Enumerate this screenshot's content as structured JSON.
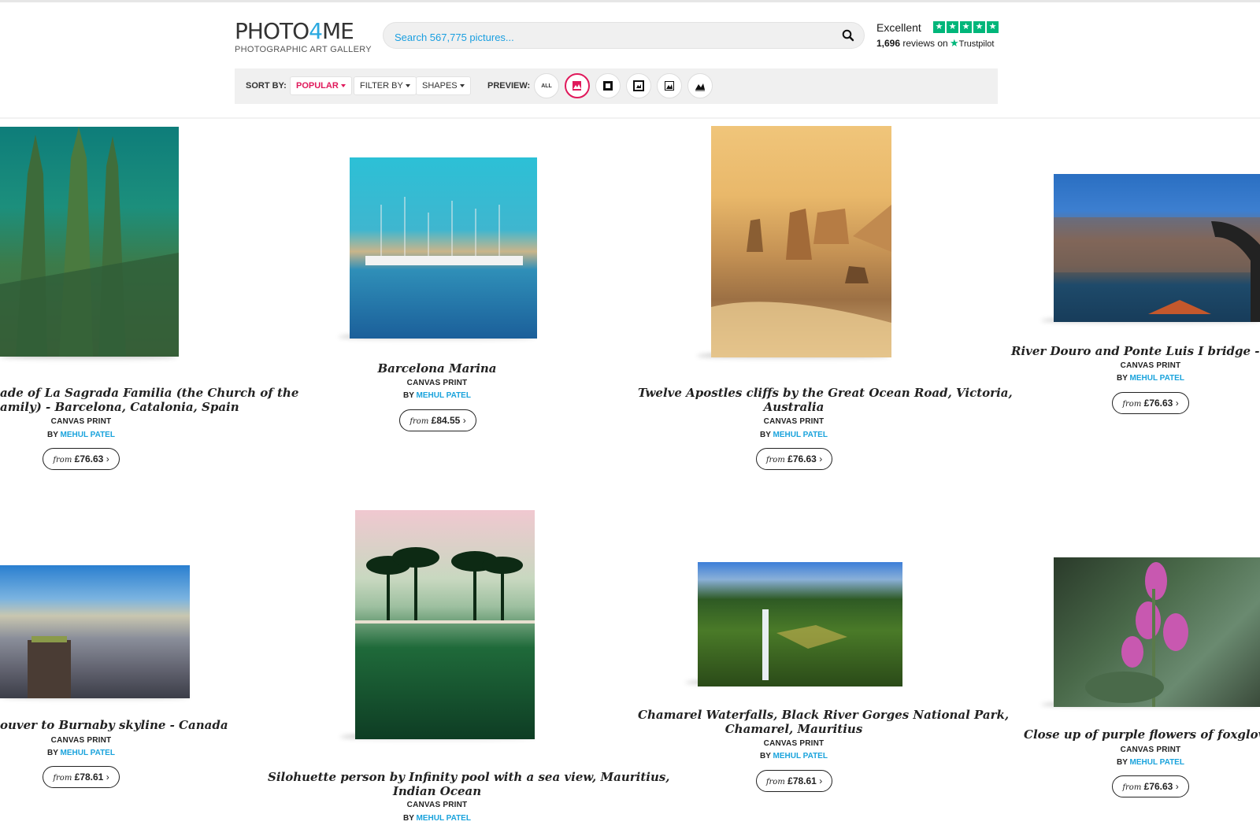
{
  "header": {
    "logo_main": "PHOTO4ME",
    "logo_sub": "PHOTOGRAPHIC ART GALLERY",
    "search_placeholder": "Search 567,775 pictures...",
    "trustpilot": {
      "rating_word": "Excellent",
      "reviews_count": "1,696",
      "reviews_text": "reviews on",
      "brand": "Trustpilot",
      "stars": 5
    }
  },
  "toolbar": {
    "sort_label": "SORT BY:",
    "sort_value": "POPULAR",
    "filter_label": "FILTER BY",
    "shapes_label": "SHAPES",
    "preview_label": "PREVIEW:",
    "preview_all": "ALL",
    "preview_options": [
      "all",
      "canvas",
      "framed-print",
      "framed-mounted",
      "poster",
      "photo-print"
    ],
    "preview_active": "canvas"
  },
  "colors": {
    "accent": "#e0195b",
    "link": "#1aa3dc",
    "trustpilot": "#00b67a"
  },
  "products": [
    {
      "title_line1": "ade of La Sagrada Familia (the Church of the",
      "title_line2": "amily) - Barcelona, Catalonia, Spain",
      "type": "CANVAS PRINT",
      "by": "BY",
      "artist": "MEHUL PATEL",
      "from": "from",
      "price": "£76.63"
    },
    {
      "title_line1": "Barcelona Marina",
      "title_line2": "",
      "type": "CANVAS PRINT",
      "by": "BY",
      "artist": "MEHUL PATEL",
      "from": "from",
      "price": "£84.55"
    },
    {
      "title_line1": "Twelve Apostles cliffs by the Great Ocean Road, Victoria,",
      "title_line2": "Australia",
      "type": "CANVAS PRINT",
      "by": "BY",
      "artist": "MEHUL PATEL",
      "from": "from",
      "price": "£76.63"
    },
    {
      "title_line1": "River Douro and Ponte Luis I bridge - Po",
      "title_line2": "",
      "type": "CANVAS PRINT",
      "by": "BY",
      "artist": "MEHUL PATEL",
      "from": "from",
      "price": "£76.63"
    },
    {
      "title_line1": "ouver to Burnaby skyline - Canada",
      "title_line2": "",
      "type": "CANVAS PRINT",
      "by": "BY",
      "artist": "MEHUL PATEL",
      "from": "from",
      "price": "£78.61"
    },
    {
      "title_line1": "Silohuette person by Infinity pool with a sea view, Mauritius,",
      "title_line2": "Indian Ocean",
      "type": "CANVAS PRINT",
      "by": "BY",
      "artist": "MEHUL PATEL",
      "from": "",
      "price": ""
    },
    {
      "title_line1": "Chamarel Waterfalls, Black River Gorges National Park,",
      "title_line2": "Chamarel, Mauritius",
      "type": "CANVAS PRINT",
      "by": "BY",
      "artist": "MEHUL PATEL",
      "from": "from",
      "price": "£78.61"
    },
    {
      "title_line1": "Close up of purple flowers of foxglove (",
      "title_line2": "",
      "type": "CANVAS PRINT",
      "by": "BY",
      "artist": "MEHUL PATEL",
      "from": "from",
      "price": "£76.63"
    }
  ]
}
